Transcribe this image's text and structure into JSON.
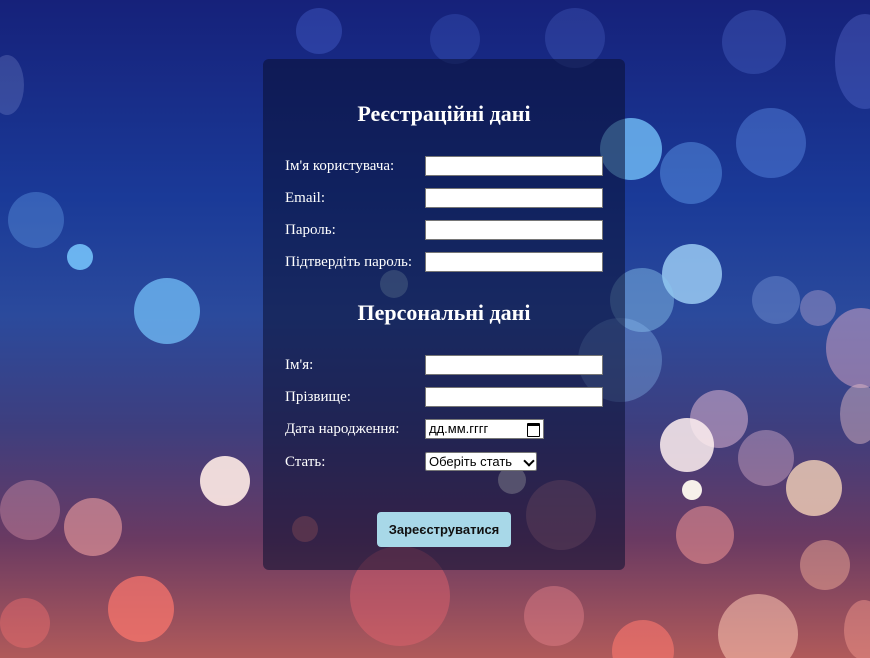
{
  "form": {
    "section_registration": "Реєстраційні дані",
    "username_label": "Ім'я користувача:",
    "email_label": "Email:",
    "password_label": "Пароль:",
    "confirm_password_label": "Підтвердіть пароль:",
    "section_personal": "Персональні дані",
    "first_name_label": "Ім'я:",
    "last_name_label": "Прізвище:",
    "birthdate_label": "Дата народження:",
    "birthdate_placeholder": "дд.мм.гггг",
    "gender_label": "Стать:",
    "gender_selected": "Оберіть стать",
    "submit_label": "Зареєструватися"
  },
  "colors": {
    "button_bg": "#a8d8e8",
    "card_bg": "rgba(10,14,50,0.55)"
  }
}
